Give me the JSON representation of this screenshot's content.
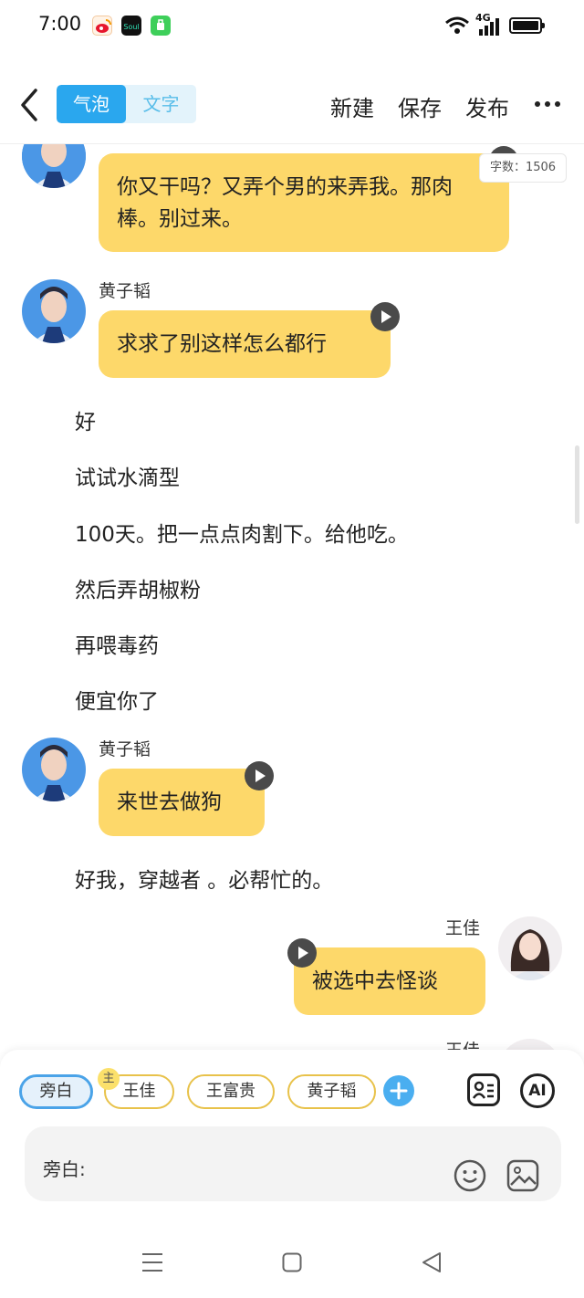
{
  "status_bar": {
    "time": "7:00",
    "app_icons": [
      "weibo-icon",
      "soul-icon",
      "green-app-icon"
    ],
    "network_label": "4G",
    "icons": [
      "wifi-icon",
      "signal-icon",
      "battery-icon"
    ]
  },
  "header": {
    "back_icon": "chevron-left-icon",
    "tab_bubble": "气泡",
    "tab_text": "文字",
    "new_label": "新建",
    "save_label": "保存",
    "publish_label": "发布",
    "more_icon": "more-dots-icon"
  },
  "word_count": "字数：1506",
  "messages": [
    {
      "type": "bubble",
      "side": "left",
      "text": "你又干吗？又弄个男的来弄我。那肉棒。别过来。"
    },
    {
      "type": "bubble",
      "side": "left",
      "speaker": "黄子韬",
      "text": "求求了别这样怎么都行"
    },
    {
      "type": "narration",
      "text": "好"
    },
    {
      "type": "narration",
      "text": "试试水滴型"
    },
    {
      "type": "narration",
      "text": "100天。把一点点肉割下。给他吃。"
    },
    {
      "type": "narration",
      "text": "然后弄胡椒粉"
    },
    {
      "type": "narration",
      "text": "再喂毒药"
    },
    {
      "type": "narration",
      "text": "便宜你了"
    },
    {
      "type": "bubble",
      "side": "left",
      "speaker": "黄子韬",
      "text": "来世去做狗"
    },
    {
      "type": "narration",
      "text": "好我，穿越者 。必帮忙的。"
    },
    {
      "type": "bubble",
      "side": "right",
      "speaker": "王佳",
      "text": "被选中去怪谈"
    },
    {
      "type": "bubble",
      "side": "right",
      "speaker": "王佳",
      "text": ""
    }
  ],
  "characters": {
    "items": [
      "旁白",
      "王佳",
      "王富贵",
      "黄子韬"
    ],
    "selected": "旁白",
    "main_badge": "主",
    "add_icon": "plus-icon"
  },
  "tools": {
    "contact_icon": "contact-card-icon",
    "ai_label": "AI"
  },
  "input": {
    "label": "旁白:",
    "emoji_icon": "smiley-icon",
    "image_icon": "image-icon"
  },
  "nav": [
    "menu-icon",
    "home-square-icon",
    "back-triangle-icon"
  ],
  "colors": {
    "bubble": "#fdd86a",
    "accent": "#2aa7ee",
    "play": "#4a4a4a"
  }
}
